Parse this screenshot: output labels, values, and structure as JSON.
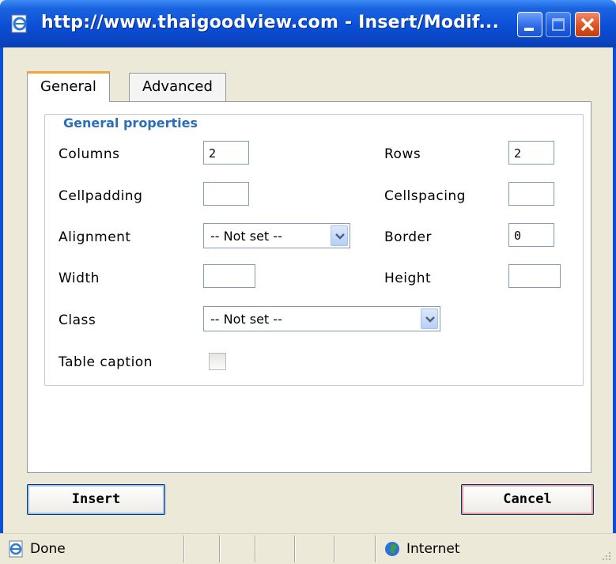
{
  "window": {
    "title": "http://www.thaigoodview.com - Insert/Modif..."
  },
  "tabs": [
    {
      "label": "General",
      "active": true
    },
    {
      "label": "Advanced",
      "active": false
    }
  ],
  "general_properties": {
    "legend": "General properties",
    "columns": {
      "label": "Columns",
      "value": "2"
    },
    "rows": {
      "label": "Rows",
      "value": "2"
    },
    "cellpadding": {
      "label": "Cellpadding",
      "value": ""
    },
    "cellspacing": {
      "label": "Cellspacing",
      "value": ""
    },
    "alignment": {
      "label": "Alignment",
      "selected": "-- Not set --"
    },
    "border": {
      "label": "Border",
      "value": "0"
    },
    "width": {
      "label": "Width",
      "value": ""
    },
    "height": {
      "label": "Height",
      "value": ""
    },
    "class": {
      "label": "Class",
      "selected": "-- Not set --"
    },
    "table_caption": {
      "label": "Table caption",
      "checked": false
    }
  },
  "buttons": {
    "insert": "Insert",
    "cancel": "Cancel"
  },
  "statusbar": {
    "status": "Done",
    "zone": "Internet"
  },
  "colors": {
    "titlebar": "#0a4fd6",
    "legend": "#2b6fb7",
    "active_tab_accent": "#f3a53a"
  }
}
